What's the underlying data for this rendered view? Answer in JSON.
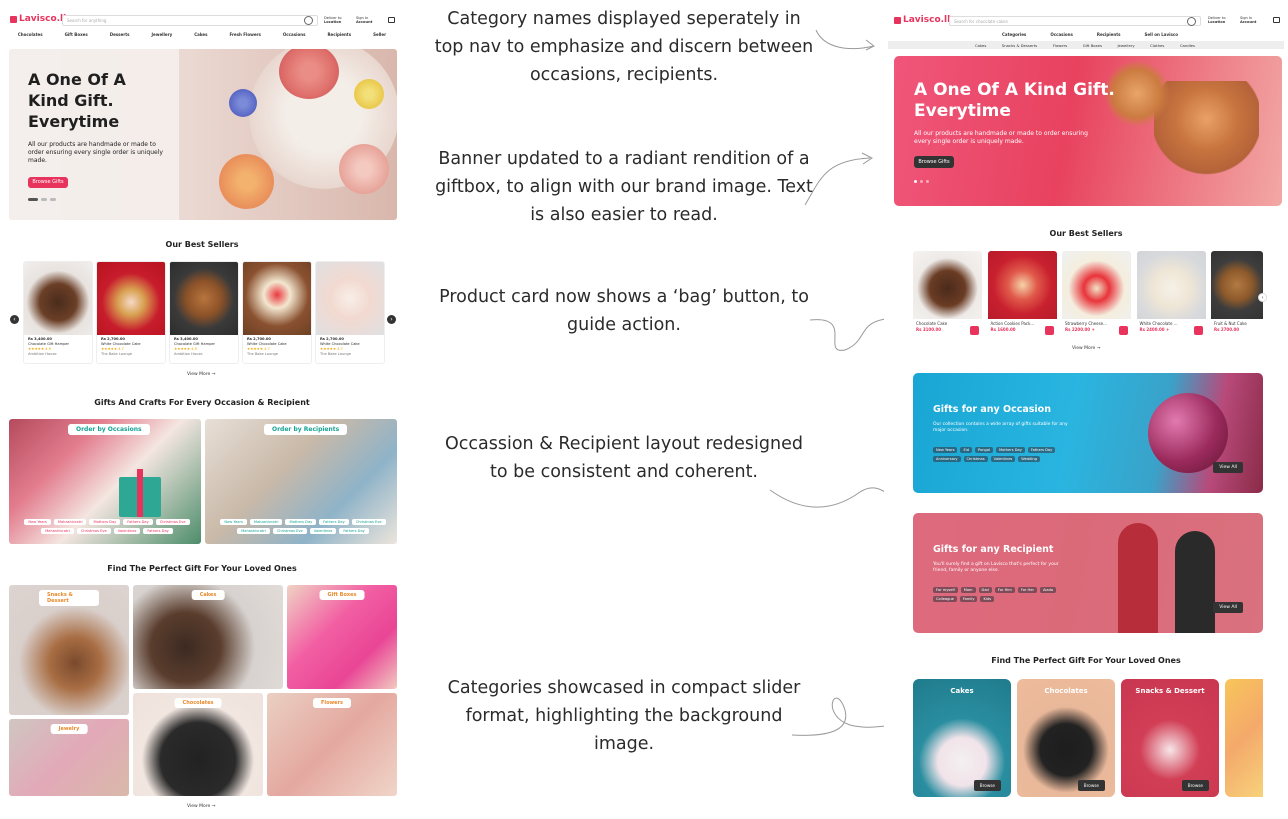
{
  "old_site": {
    "logo": "Lavisco.lk",
    "search_placeholder": "Search for anything",
    "deliver_label": "Deliver to",
    "deliver_value": "Location",
    "signin_label": "Sign In",
    "signin_value": "Account",
    "nav": [
      "Chocolates",
      "Gift Boxes",
      "Desserts",
      "Jewellery",
      "Cakes",
      "Fresh Flowers",
      "Occasions",
      "Recipients",
      "Seller"
    ],
    "banner": {
      "title_lines": [
        "A One Of A",
        "Kind Gift.",
        "Everytime"
      ],
      "text": "All our products are handmade or made to order ensuring every single order is uniquely made.",
      "button": "Browse Gifts"
    },
    "best_sellers_title": "Our Best Sellers",
    "products": [
      {
        "price": "Rs 3,400.00",
        "name": "Chocolate Gift Hamper",
        "rating": "★★★★★ 4.9",
        "seller": "Ambition House"
      },
      {
        "price": "Rs 2,700.00",
        "name": "White Chocolate Cake",
        "rating": "★★★★★ 4.7",
        "seller": "The Bake Lounge"
      },
      {
        "price": "Rs 3,400.00",
        "name": "Chocolate Gift Hamper",
        "rating": "★★★★★ 4.9",
        "seller": "Ambition House"
      },
      {
        "price": "Rs 2,700.00",
        "name": "White Chocolate Cake",
        "rating": "★★★★★ 4.7",
        "seller": "The Bake Lounge"
      },
      {
        "price": "Rs 2,700.00",
        "name": "White Chocolate Cake",
        "rating": "★★★★★ 4.7",
        "seller": "The Bake Lounge"
      }
    ],
    "view_more": "View More →",
    "occasion_title": "Gifts And Crafts For Every Occasion & Recipient",
    "order_by_occasions": "Order by Occasions",
    "order_by_recipients": "Order by Recipients",
    "occasion_tags": [
      "New Years",
      "Mahashivratri",
      "Mothers Day",
      "Fathers Day",
      "Christmas Eve",
      "Mahashivratri",
      "Christmas Eve",
      "Valentines",
      "Fathers Day"
    ],
    "recipient_tags": [
      "New Years",
      "Mahashivratri",
      "Mothers Day",
      "Fathers Day",
      "Christmas Eve",
      "Mahashivratri",
      "Christmas Eve",
      "Valentines",
      "Fathers Day"
    ],
    "loved_ones_title": "Find The Perfect Gift For Your Loved Ones",
    "categories": [
      "Snacks & Dessert",
      "Cakes",
      "Gift Boxes",
      "Chocolates",
      "Flowers",
      "Jewelry"
    ],
    "view_more_2": "View More →"
  },
  "notes": [
    "Category names displayed seperately in top nav to emphasize and discern between occasions, recipients.",
    "Banner updated to a radiant rendition of a giftbox, to align with our brand image. Text is also easier to read.",
    "Product card now shows a ‘bag’ button, to guide action.",
    "Occassion & Recipient layout redesigned to be consistent and coherent.",
    "Categories showcased in compact slider format, highlighting the background image."
  ],
  "new_site": {
    "logo": "Lavisco.lk",
    "search_placeholder": "Search for chocolate cakes",
    "deliver_label": "Deliver to",
    "deliver_value": "Location",
    "signin_label": "Sign In",
    "signin_value": "Account",
    "nav_top": [
      "Categories",
      "Occasions",
      "Recipients",
      "Sell on Lavisco"
    ],
    "nav_sub": [
      "Cakes",
      "Snacks & Desserts",
      "Flowers",
      "Gift Boxes",
      "Jewellery",
      "Clothes",
      "Candles"
    ],
    "banner": {
      "title_lines": [
        "A One Of A Kind Gift.",
        "Everytime"
      ],
      "text": "All our products are handmade or made to order ensuring every single order is uniquely made.",
      "button": "Browse Gifts"
    },
    "best_sellers_title": "Our Best Sellers",
    "products": [
      {
        "name": "Chocolate Cake",
        "price": "Rs 3100.00"
      },
      {
        "name": "Action Cookies Pack...",
        "price": "Rs 1600.00"
      },
      {
        "name": "Strawberry Cheese...",
        "price": "Rs 2200.00 +"
      },
      {
        "name": "White Chocolate ...",
        "price": "Rs 2400.00 +"
      },
      {
        "name": "Fruit & Nut Cake",
        "price": "Rs 2700.00"
      }
    ],
    "view_more": "View More →",
    "occasion_card": {
      "title": "Gifts for any Occasion",
      "text": "Our collection contains a wide array of gifts suitable for any major occasion.",
      "tags": [
        "New Years",
        "Eid",
        "Pongal",
        "Mothers Day",
        "Fathers Day",
        "Anniversary",
        "Christmas",
        "Valentines",
        "Wedding"
      ],
      "button": "View All"
    },
    "recipient_card": {
      "title": "Gifts for any Recipient",
      "text": "You'll surely find a gift on Lavisco that's perfect for your friend, family or anyone else.",
      "tags": [
        "For myself",
        "Mom",
        "Dad",
        "For Him",
        "For Her",
        "Aiada",
        "Colleague",
        "Family",
        "Kids"
      ],
      "button": "View All"
    },
    "loved_ones_title": "Find The Perfect Gift For Your Loved Ones",
    "slides": [
      "Cakes",
      "Chocolates",
      "Snacks & Dessert"
    ],
    "browse": "Browse"
  },
  "colors": {
    "brand_pink": "#e8335c",
    "teal": "#16a394",
    "dark": "#333333"
  }
}
